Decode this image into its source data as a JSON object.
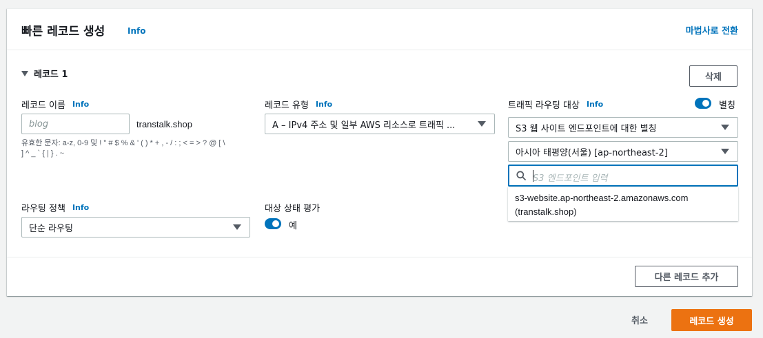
{
  "header": {
    "title": "빠른 레코드 생성",
    "info": "Info",
    "wizard_link": "마법사로 전환"
  },
  "record": {
    "section_label": "레코드 1",
    "delete_button": "삭제",
    "name": {
      "label": "레코드 이름",
      "info": "Info",
      "placeholder": "blog",
      "value": "",
      "domain_suffix": "transtalk.shop",
      "hint_line1": "유효한 문자: a-z, 0-9 및 ! \" # $ % & ' ( ) * + , - / : ; < = > ? @ [ \\",
      "hint_line2": "] ^ _ ` { | } . ~"
    },
    "type": {
      "label": "레코드 유형",
      "info": "Info",
      "selected": "A – IPv4 주소 및 일부 AWS 리소스로 트래픽 ..."
    },
    "target": {
      "label": "트래픽 라우팅 대상",
      "info": "Info",
      "alias_label": "별칭",
      "alias_enabled": true,
      "endpoint_type": "S3 웹 사이트 엔드포인트에 대한 별칭",
      "region": "아시아 태평양(서울) [ap-northeast-2]",
      "search_placeholder": "S3 엔드포인트 입력",
      "option_line1": "s3-website.ap-northeast-2.amazonaws.com",
      "option_line2": "(transtalk.shop)"
    },
    "routing": {
      "label": "라우팅 정책",
      "info": "Info",
      "selected": "단순 라우팅"
    },
    "health": {
      "label": "대상 상태 평가",
      "value_label": "예",
      "enabled": true
    }
  },
  "add_record_button": "다른 레코드 추가",
  "footer": {
    "cancel": "취소",
    "create": "레코드 생성"
  },
  "colors": {
    "link": "#0073bb",
    "primary": "#ec7211",
    "toggle_on": "#0073bb"
  }
}
